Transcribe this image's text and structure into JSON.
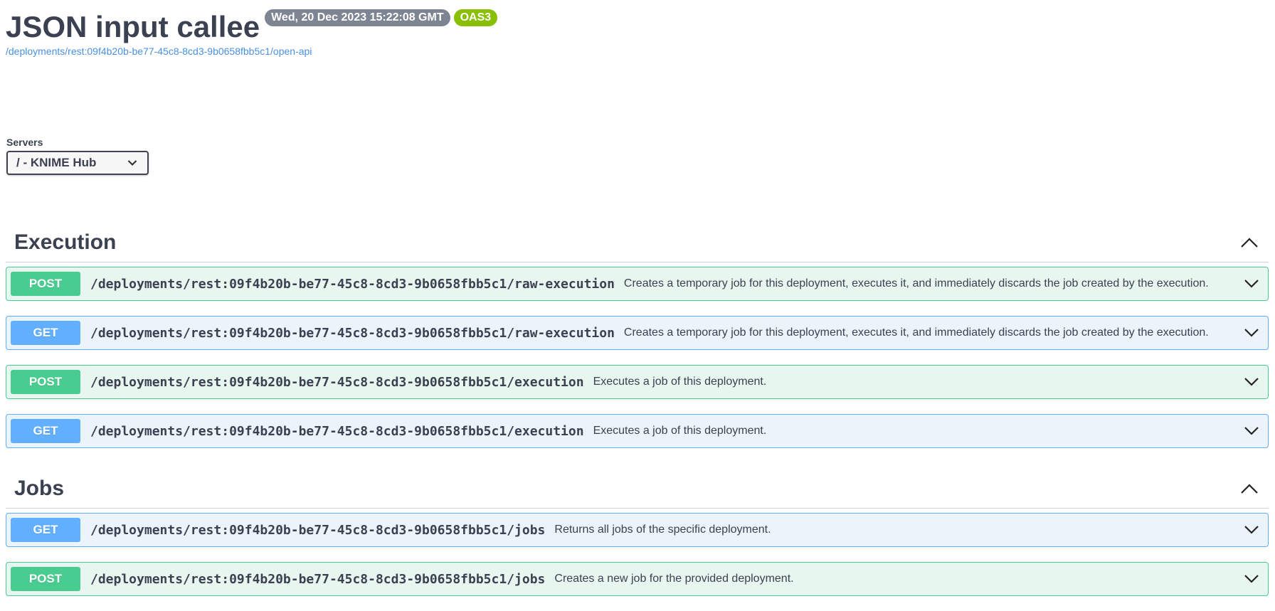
{
  "info": {
    "title": "JSON input callee",
    "version_badge": "Wed, 20 Dec 2023 15:22:08 GMT",
    "oas_badge": "OAS3",
    "spec_url": "/deployments/rest:09f4b20b-be77-45c8-8cd3-9b0658fbb5c1/open-api"
  },
  "servers": {
    "label": "Servers",
    "selected": "/ - KNIME Hub"
  },
  "sections": [
    {
      "title": "Execution",
      "operations": [
        {
          "method": "POST",
          "path": "/deployments/rest:09f4b20b-be77-45c8-8cd3-9b0658fbb5c1/raw-execution",
          "summary": "Creates a temporary job for this deployment, executes it, and immediately discards the job created by the execution."
        },
        {
          "method": "GET",
          "path": "/deployments/rest:09f4b20b-be77-45c8-8cd3-9b0658fbb5c1/raw-execution",
          "summary": "Creates a temporary job for this deployment, executes it, and immediately discards the job created by the execution."
        },
        {
          "method": "POST",
          "path": "/deployments/rest:09f4b20b-be77-45c8-8cd3-9b0658fbb5c1/execution",
          "summary": "Executes a job of this deployment."
        },
        {
          "method": "GET",
          "path": "/deployments/rest:09f4b20b-be77-45c8-8cd3-9b0658fbb5c1/execution",
          "summary": "Executes a job of this deployment."
        }
      ]
    },
    {
      "title": "Jobs",
      "operations": [
        {
          "method": "GET",
          "path": "/deployments/rest:09f4b20b-be77-45c8-8cd3-9b0658fbb5c1/jobs",
          "summary": "Returns all jobs of the specific deployment."
        },
        {
          "method": "POST",
          "path": "/deployments/rest:09f4b20b-be77-45c8-8cd3-9b0658fbb5c1/jobs",
          "summary": "Creates a new job for the provided deployment."
        }
      ]
    }
  ],
  "colors": {
    "post": "#49cc90",
    "get": "#61affe",
    "version_badge": "#7d8492",
    "oas_badge": "#89bf04",
    "link": "#4990e2"
  },
  "icons": {
    "section_toggle": "chevron-up-icon",
    "operation_toggle": "chevron-down-icon",
    "select_arrow": "chevron-down-icon"
  }
}
